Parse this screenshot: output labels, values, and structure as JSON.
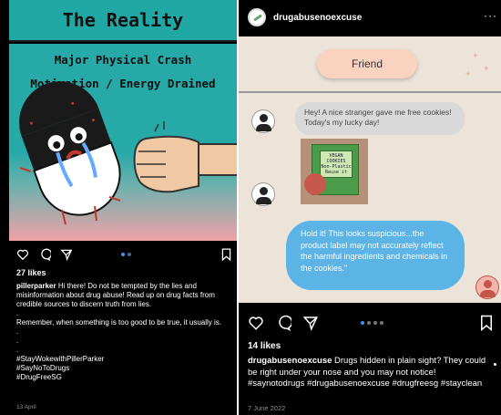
{
  "left_post": {
    "image_title": "The Reality",
    "image_line1": "Major Physical Crash",
    "image_line2": "Motivation / Energy Drained",
    "likes": "27 likes",
    "username": "pillerparker",
    "caption_lines": [
      "Hi there! Do not be tempted by the lies and misinformation about drug abuse! Read up on drug facts from credible sources to discern truth from lies.",
      ".",
      "Remember, when something is too good to be true, it usually is.",
      ".",
      ".",
      ".",
      "#StayWokewithPillerParker",
      "#SayNoToDrugs",
      "#DrugFreeSG"
    ],
    "date": "13 April"
  },
  "right_post": {
    "username": "drugabusenoexcuse",
    "more_label": "···",
    "friend_label": "Friend",
    "bubble1": "Hey! A nice stranger gave me free cookies! Today's my lucky day!",
    "package_label": "VEGAN COOKIES Non-Plastic Reuse it",
    "bubble2": "Hold it! This looks suspicious...the product label may not accurately reflect the harmful ingredients and chemicals in the cookies.\"",
    "likes": "14 likes",
    "caption_user": "drugabusenoexcuse",
    "caption_text": "Drugs hidden in plain sight? They could be right under your nose and you may not notice! #saynotodrugs #drugabusenoexcuse #drugfreesg #stayclean",
    "date": "7 June 2022"
  },
  "icons": [
    "heart-icon",
    "comment-icon",
    "share-icon",
    "bookmark-icon",
    "more-icon"
  ],
  "colors": {
    "teal": "#1fa8a4",
    "pink": "#f0a2a8",
    "beige": "#ece4d8",
    "bubble_blue": "#5bb3e6",
    "accent_blue": "#3897f0"
  }
}
